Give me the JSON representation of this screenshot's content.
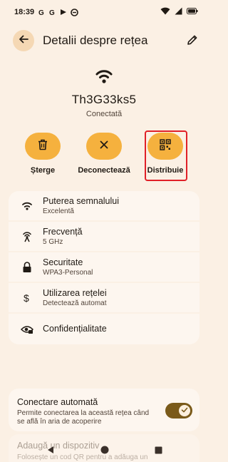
{
  "status_bar": {
    "time": "18:39",
    "icons": [
      "google-g-icon",
      "google-g-icon",
      "play-games-icon",
      "browser-icon"
    ],
    "right_icons": [
      "wifi-icon",
      "signal-icon",
      "battery-icon"
    ]
  },
  "header": {
    "title": "Detalii despre rețea",
    "back_icon": "arrow-left-icon",
    "edit_icon": "pencil-icon"
  },
  "network": {
    "name": "Th3G33ks5",
    "status": "Conectată"
  },
  "actions": [
    {
      "label": "Șterge",
      "icon": "trash-icon"
    },
    {
      "label": "Deconectează",
      "icon": "close-icon"
    },
    {
      "label": "Distribuie",
      "icon": "qr-code-icon",
      "highlighted": true
    }
  ],
  "details": [
    {
      "title": "Puterea semnalului",
      "subtitle": "Excelentă",
      "icon": "wifi-icon"
    },
    {
      "title": "Frecvență",
      "subtitle": "5 GHz",
      "icon": "antenna-icon"
    },
    {
      "title": "Securitate",
      "subtitle": "WPA3-Personal",
      "icon": "lock-icon"
    },
    {
      "title": "Utilizarea rețelei",
      "subtitle": "Detectează automat",
      "icon": "dollar-icon"
    },
    {
      "title": "Confidențialitate",
      "subtitle": "",
      "icon": "privacy-eye-icon"
    }
  ],
  "auto_connect": {
    "title": "Conectare automată",
    "subtitle": "Permite conectarea la această rețea când se află în aria de acoperire",
    "enabled": true
  },
  "add_device": {
    "title": "Adaugă un dispozitiv",
    "subtitle": "Folosește un cod QR pentru a adăuga un"
  },
  "colors": {
    "background": "#fbf0e4",
    "card": "#fdf6ef",
    "accent": "#f5b13e",
    "highlight": "#e02028",
    "toggle": "#7a5a1a"
  }
}
